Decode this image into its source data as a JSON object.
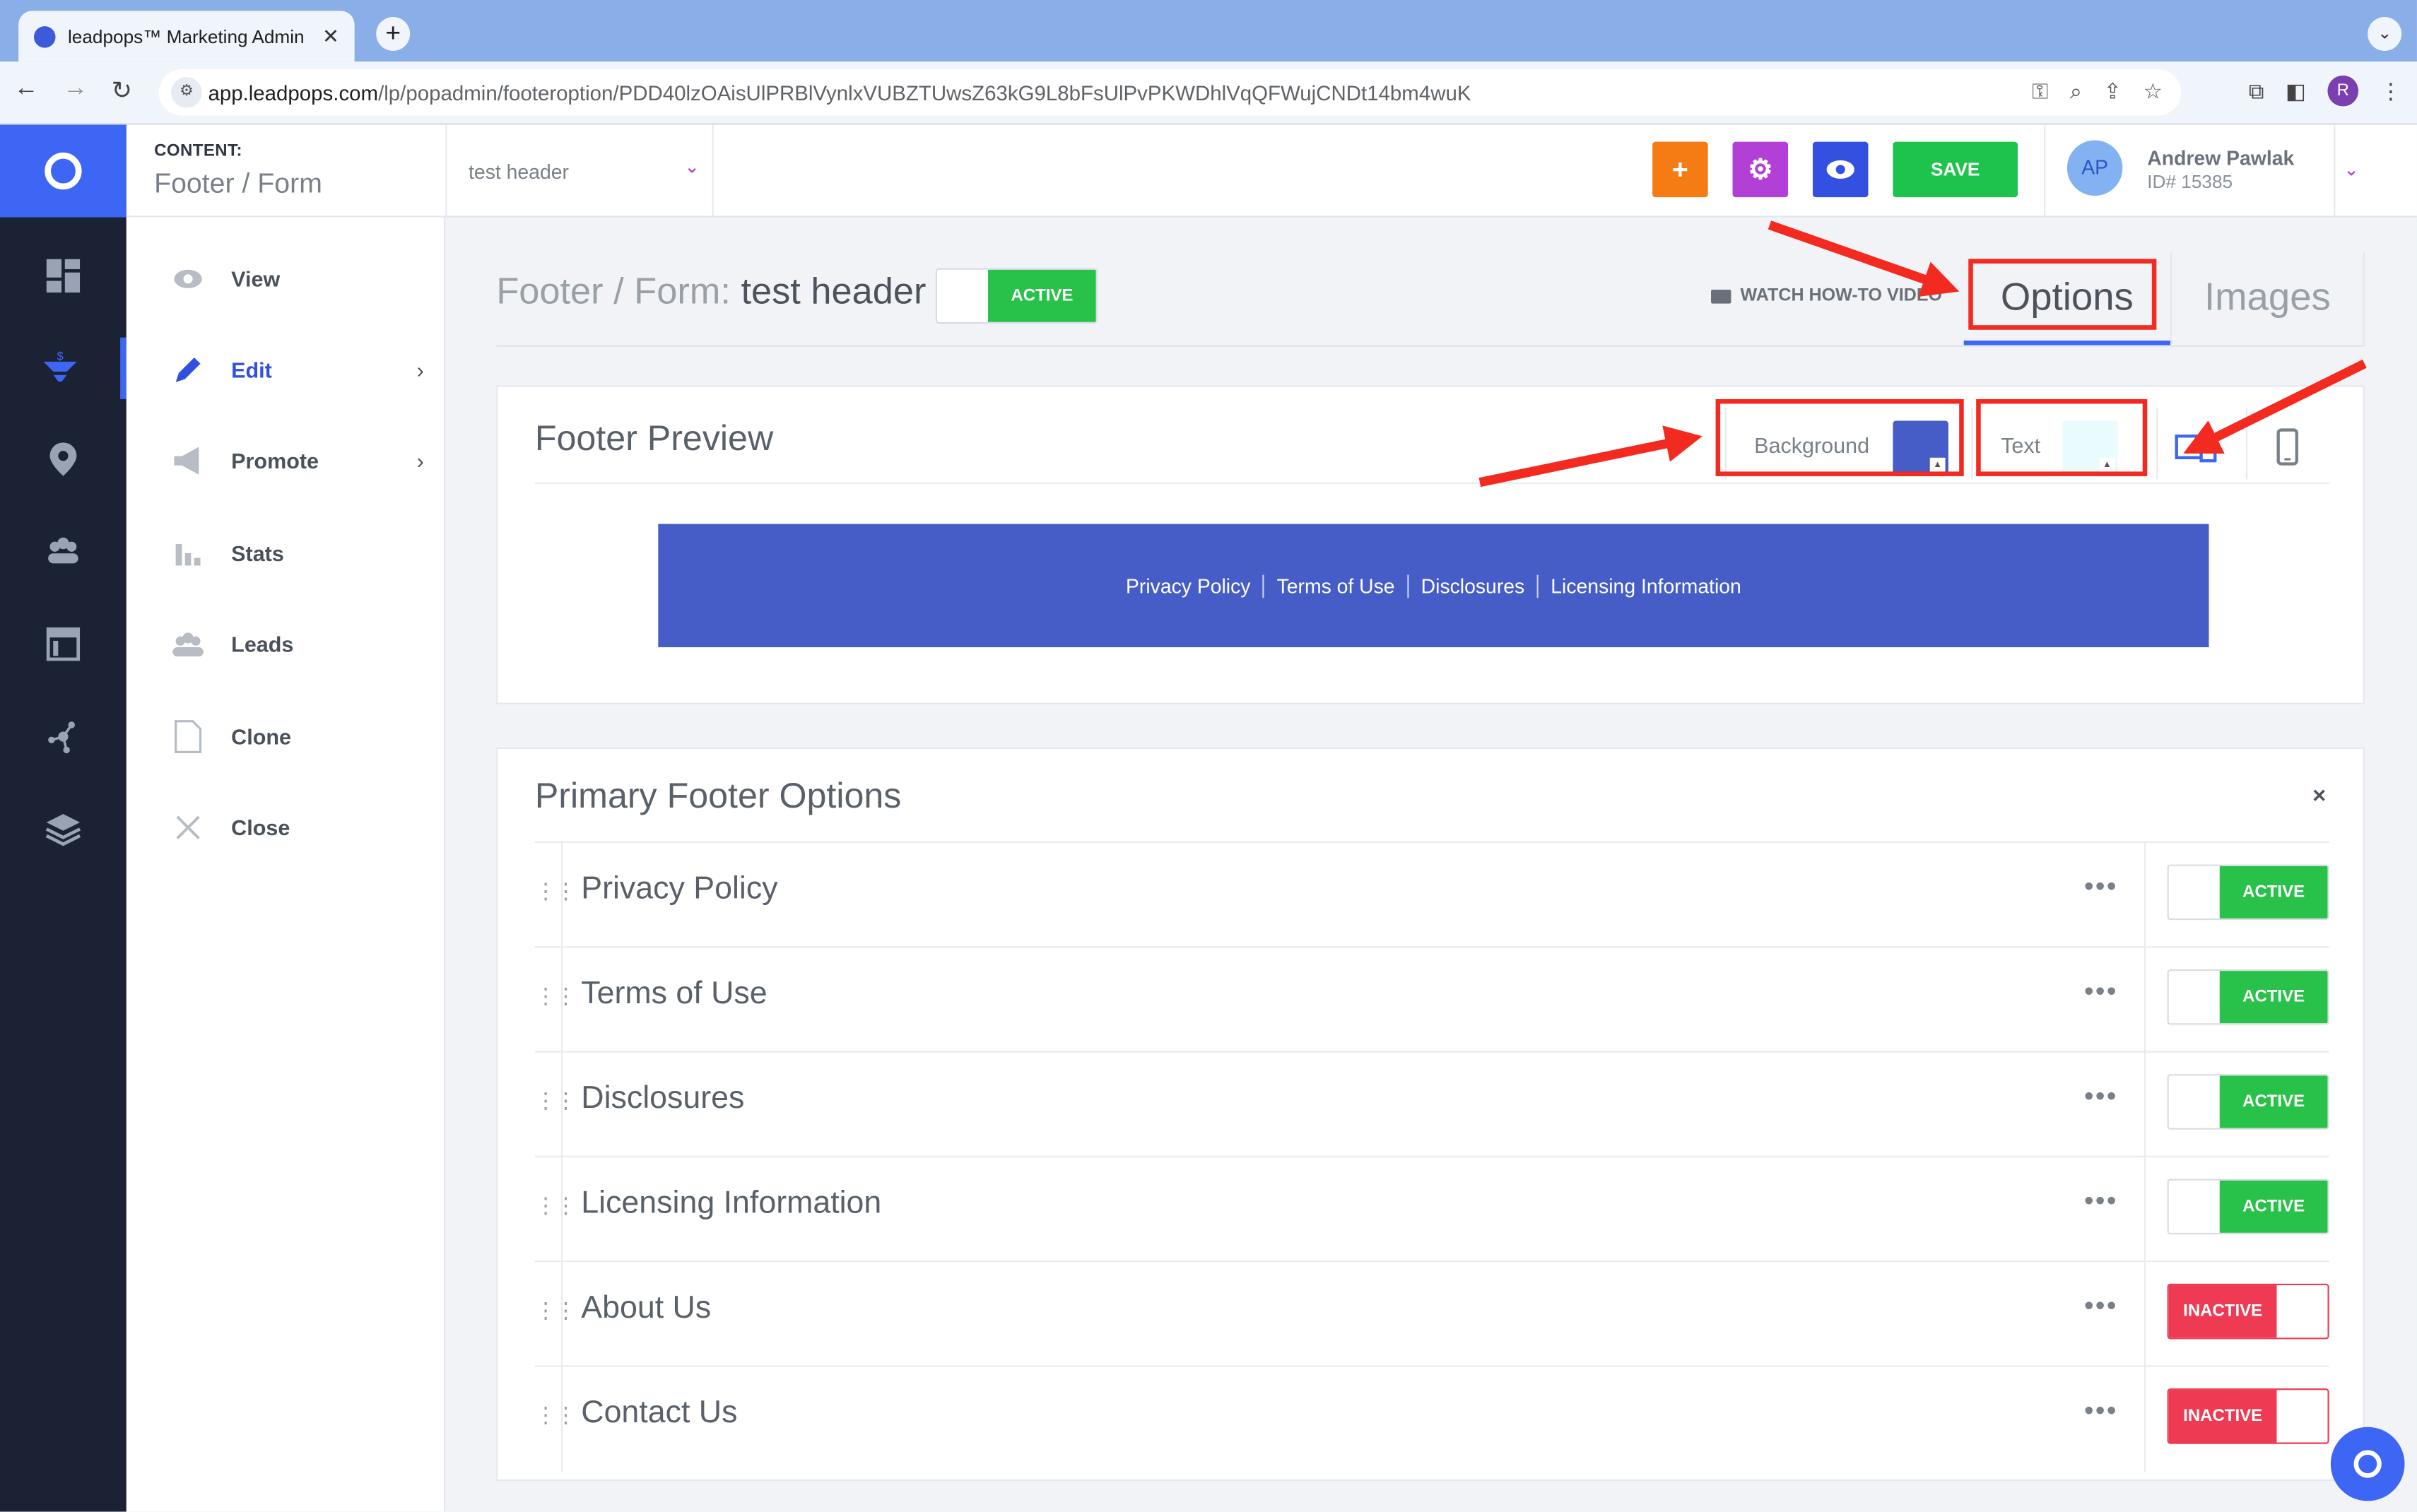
{
  "browser": {
    "tab_title": "leadpops™ Marketing Admin |",
    "tab_close": "✕",
    "new_tab": "+",
    "tab_menu": "⌄",
    "url_host": "app.leadpops.com",
    "url_path": "/lp/popadmin/footeroption/PDD40lzOAisUlPRBlVynlxVUBZTUwsZ63kG9L8bFsUlPvPKWDhlVqQFWujCNDt14bm4wuK",
    "profile_initial": "R"
  },
  "header": {
    "content_label": "CONTENT:",
    "content_value": "Footer / Form",
    "funnel_select_value": "test header",
    "save_label": "SAVE",
    "user_initials": "AP",
    "user_name": "Andrew Pawlak",
    "user_id": "ID# 15385"
  },
  "sidebar_menu": [
    {
      "label": "View"
    },
    {
      "label": "Edit"
    },
    {
      "label": "Promote"
    },
    {
      "label": "Stats"
    },
    {
      "label": "Leads"
    },
    {
      "label": "Clone"
    },
    {
      "label": "Close"
    }
  ],
  "main": {
    "title_prefix": "Footer / Form:",
    "title_name": "test header",
    "title_toggle": "ACTIVE",
    "watch_video": "WATCH HOW-TO VIDEO",
    "tab_options": "Options",
    "tab_images": "Images"
  },
  "preview": {
    "title": "Footer Preview",
    "background_label": "Background",
    "text_label": "Text",
    "colors": {
      "background": "#465cc6",
      "text": "#eafbfd"
    },
    "links": [
      "Privacy Policy",
      "Terms of Use",
      "Disclosures",
      "Licensing Information"
    ]
  },
  "options": {
    "title": "Primary Footer Options",
    "close": "×",
    "rows": [
      {
        "name": "Privacy Policy",
        "state": "ACTIVE"
      },
      {
        "name": "Terms of Use",
        "state": "ACTIVE"
      },
      {
        "name": "Disclosures",
        "state": "ACTIVE"
      },
      {
        "name": "Licensing Information",
        "state": "ACTIVE"
      },
      {
        "name": "About Us",
        "state": "INACTIVE"
      },
      {
        "name": "Contact Us",
        "state": "INACTIVE"
      }
    ]
  },
  "icons": {
    "more": "•••",
    "grip": "⋮⋮",
    "chevron_right": "›",
    "chevron_down": "⌄"
  },
  "colors": {
    "accent": "#3d66f5",
    "active": "#28c24a",
    "inactive": "#ee3a52",
    "annotation": "#f32a20"
  }
}
